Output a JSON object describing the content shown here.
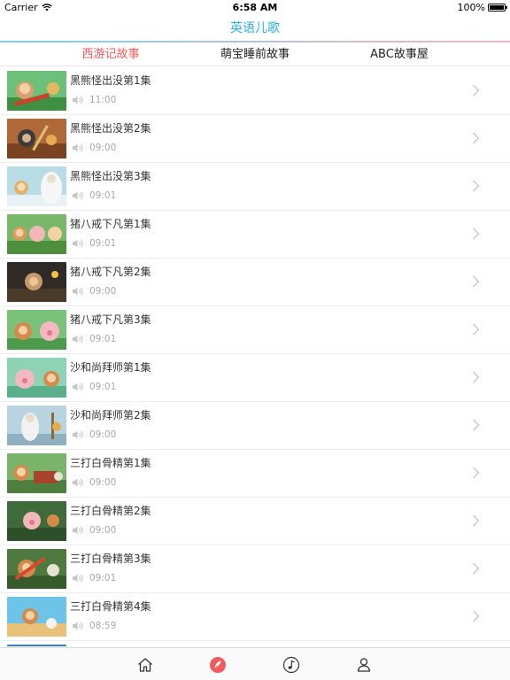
{
  "status_bar": {
    "carrier": "Carrier",
    "time": "6:58 AM",
    "battery": "100%"
  },
  "nav": {
    "title": "英语儿歌"
  },
  "tabs": [
    {
      "label": "西游记故事",
      "active": true
    },
    {
      "label": "萌宝睡前故事",
      "active": false
    },
    {
      "label": "ABC故事屋",
      "active": false
    }
  ],
  "colors": {
    "accent": "#2bb3e0",
    "active_tab": "#f25b5b",
    "tabbar_active": "#f25b5b"
  },
  "episodes": [
    {
      "title": "黑熊怪出没第1集",
      "duration": "11:00"
    },
    {
      "title": "黑熊怪出没第2集",
      "duration": "09:00"
    },
    {
      "title": "黑熊怪出没第3集",
      "duration": "09:01"
    },
    {
      "title": "猪八戒下凡第1集",
      "duration": "09:01"
    },
    {
      "title": "猪八戒下凡第2集",
      "duration": "09:00"
    },
    {
      "title": "猪八戒下凡第3集",
      "duration": "09:01"
    },
    {
      "title": "沙和尚拜师第1集",
      "duration": "09:01"
    },
    {
      "title": "沙和尚拜师第2集",
      "duration": "09:00"
    },
    {
      "title": "三打白骨精第1集",
      "duration": "09:00"
    },
    {
      "title": "三打白骨精第2集",
      "duration": "09:00"
    },
    {
      "title": "三打白骨精第3集",
      "duration": "09:01"
    },
    {
      "title": "三打白骨精第4集",
      "duration": "08:59"
    }
  ],
  "tabbar": [
    {
      "icon": "home-icon",
      "active": false
    },
    {
      "icon": "feather-icon",
      "active": true
    },
    {
      "icon": "music-note-icon",
      "active": false
    },
    {
      "icon": "user-icon",
      "active": false
    }
  ]
}
